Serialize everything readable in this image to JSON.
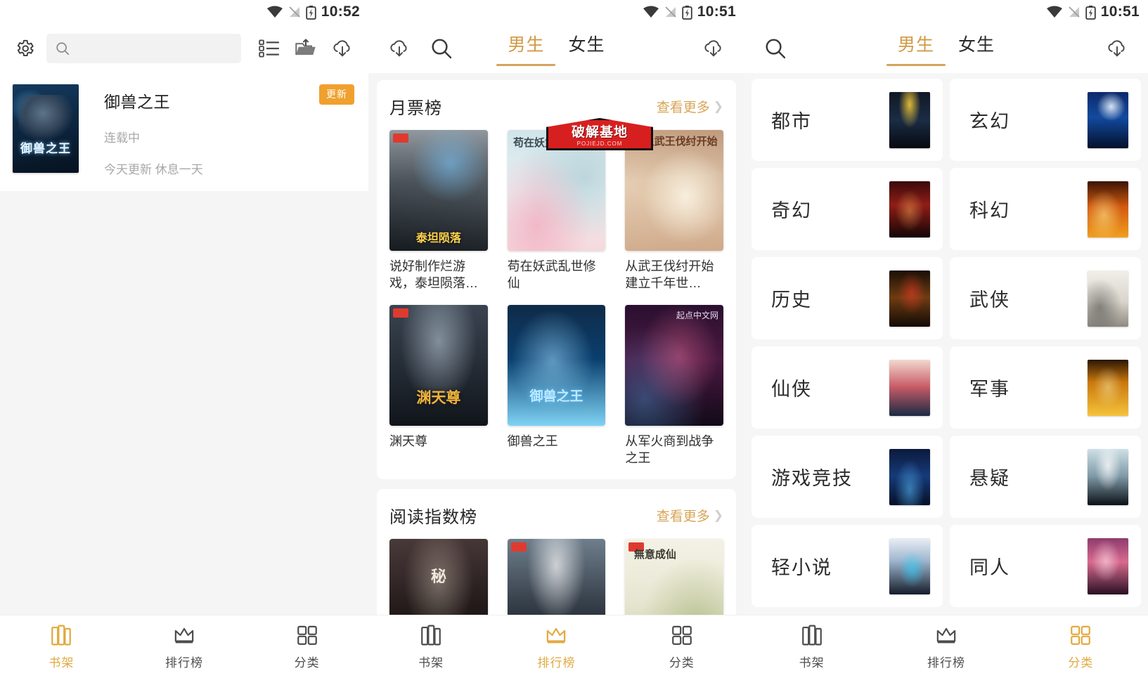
{
  "accent": "#d7a555",
  "badge_color": "#f0a02e",
  "panels": [
    {
      "id": "bookshelf",
      "status": {
        "time": "10:52"
      },
      "search": {
        "placeholder": "",
        "value": ""
      },
      "toolbar": {
        "gear": "settings-icon",
        "list": "list-view-icon",
        "import": "import-folder-icon",
        "download": "cloud-download-icon"
      },
      "shelf": [
        {
          "title": "御兽之王",
          "cover_text": "御兽之王",
          "status": "连载中",
          "note": "今天更新 休息一天",
          "badge": "更新"
        }
      ],
      "nav": [
        {
          "label": "书架",
          "icon": "bookshelf-icon",
          "active": true
        },
        {
          "label": "排行榜",
          "icon": "crown-icon",
          "active": false
        },
        {
          "label": "分类",
          "icon": "grid-icon",
          "active": false
        }
      ]
    },
    {
      "id": "ranking",
      "status": {
        "time": "10:51"
      },
      "toolbar": {
        "download": "cloud-download-icon",
        "search": "search-icon"
      },
      "tabs": [
        {
          "label": "男生",
          "active": true
        },
        {
          "label": "女生",
          "active": false
        }
      ],
      "watermark": {
        "main": "破解基地",
        "sub": "POJIEJD.COM"
      },
      "sections": [
        {
          "title": "月票榜",
          "more": "查看更多",
          "books": [
            {
              "name": "说好制作烂游戏，泰坦陨落…",
              "cover": "c-titan",
              "cover_text": "泰坦陨落",
              "tag": true
            },
            {
              "name": "苟在妖武乱世修仙",
              "cover": "c-xian",
              "cover_text": "苟在妖武乱世修仙",
              "tag": false
            },
            {
              "name": "从武王伐纣开始建立千年世…",
              "cover": "c-wu",
              "cover_text": "从武王伐纣开始",
              "tag": false
            },
            {
              "name": "渊天尊",
              "cover": "c-yuan",
              "cover_text": "渊天尊",
              "tag": true
            },
            {
              "name": "御兽之王",
              "cover": "c-yushou",
              "cover_text": "御兽之王",
              "tag": false
            },
            {
              "name": "从军火商到战争之王",
              "cover": "c-junhuo",
              "cover_text": "起点中文网",
              "tag": false
            }
          ]
        },
        {
          "title": "阅读指数榜",
          "more": "查看更多",
          "books": [
            {
              "name": "",
              "cover": "c-mi",
              "cover_text": "秘",
              "tag": false
            },
            {
              "name": "",
              "cover": "c-dark",
              "cover_text": "",
              "tag": true
            },
            {
              "name": "",
              "cover": "c-wuyi",
              "cover_text": "無意成仙",
              "tag": true
            }
          ]
        }
      ],
      "nav": [
        {
          "label": "书架",
          "icon": "bookshelf-icon",
          "active": false
        },
        {
          "label": "排行榜",
          "icon": "crown-icon",
          "active": true
        },
        {
          "label": "分类",
          "icon": "grid-icon",
          "active": false
        }
      ]
    },
    {
      "id": "categories",
      "status": {
        "time": "10:51"
      },
      "toolbar": {
        "search": "search-icon",
        "download": "cloud-download-icon"
      },
      "tabs": [
        {
          "label": "男生",
          "active": true
        },
        {
          "label": "女生",
          "active": false
        }
      ],
      "categories": [
        {
          "label": "都市",
          "thumb": "t1"
        },
        {
          "label": "玄幻",
          "thumb": "t2"
        },
        {
          "label": "奇幻",
          "thumb": "t3"
        },
        {
          "label": "科幻",
          "thumb": "t4"
        },
        {
          "label": "历史",
          "thumb": "t5"
        },
        {
          "label": "武侠",
          "thumb": "t6"
        },
        {
          "label": "仙侠",
          "thumb": "t7"
        },
        {
          "label": "军事",
          "thumb": "t8"
        },
        {
          "label": "游戏竞技",
          "thumb": "t9"
        },
        {
          "label": "悬疑",
          "thumb": "t10"
        },
        {
          "label": "轻小说",
          "thumb": "t11"
        },
        {
          "label": "同人",
          "thumb": "t12"
        }
      ],
      "nav": [
        {
          "label": "书架",
          "icon": "bookshelf-icon",
          "active": false
        },
        {
          "label": "排行榜",
          "icon": "crown-icon",
          "active": false
        },
        {
          "label": "分类",
          "icon": "grid-icon",
          "active": true
        }
      ]
    }
  ]
}
